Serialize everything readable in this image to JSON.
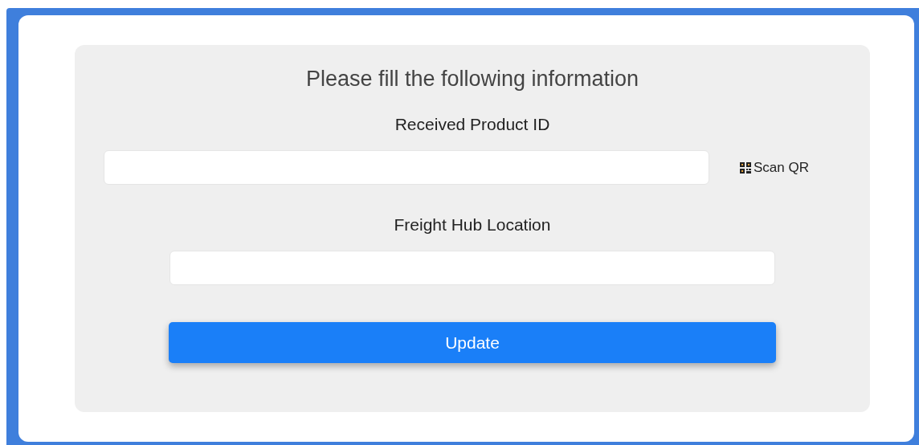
{
  "form": {
    "title": "Please fill the following information",
    "fields": [
      {
        "label": "Received Product ID",
        "scan_button": "Scan QR"
      },
      {
        "label": "Freight Hub Location"
      }
    ],
    "submit_button": "Update"
  }
}
